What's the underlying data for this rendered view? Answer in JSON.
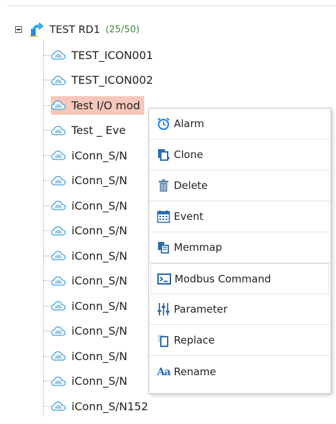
{
  "tree": {
    "root": {
      "label": "TEST RD1",
      "count": "(25/50)",
      "expander_icon": "collapse-minus-icon",
      "icon": "blue-arrow-folder-icon"
    },
    "children": [
      {
        "label": "TEST_ICON001",
        "icon": "cloud-icon"
      },
      {
        "label": "TEST_ICON002",
        "icon": "cloud-icon"
      },
      {
        "label": "Test I/O mod",
        "icon": "cloud-icon",
        "selected": true
      },
      {
        "label": "Test _ Eve",
        "icon": "cloud-icon"
      },
      {
        "label": "iConn_S/N",
        "icon": "cloud-icon"
      },
      {
        "label": "iConn_S/N",
        "icon": "cloud-icon"
      },
      {
        "label": "iConn_S/N",
        "icon": "cloud-icon"
      },
      {
        "label": "iConn_S/N",
        "icon": "cloud-icon"
      },
      {
        "label": "iConn_S/N",
        "icon": "cloud-icon"
      },
      {
        "label": "iConn_S/N",
        "icon": "cloud-icon"
      },
      {
        "label": "iConn_S/N",
        "icon": "cloud-icon"
      },
      {
        "label": "iConn_S/N",
        "icon": "cloud-icon"
      },
      {
        "label": "iConn_S/N",
        "icon": "cloud-icon"
      },
      {
        "label": "iConn_S/N",
        "icon": "cloud-icon"
      },
      {
        "label": "iConn_S/N152",
        "icon": "cloud-icon"
      }
    ],
    "selected_highlight_color": "#f6c7bb"
  },
  "context_menu": {
    "items": [
      {
        "label": "Alarm",
        "icon": "alarm-clock-icon"
      },
      {
        "label": "Clone",
        "icon": "clone-icon"
      },
      {
        "label": "Delete",
        "icon": "trash-icon"
      },
      {
        "label": "Event",
        "icon": "calendar-icon"
      },
      {
        "label": "Memmap",
        "icon": "memmap-icon"
      },
      {
        "label": "Modbus Command",
        "icon": "terminal-icon",
        "hovered": true
      },
      {
        "label": "Parameter",
        "icon": "sliders-icon"
      },
      {
        "label": "Replace",
        "icon": "replace-icon"
      },
      {
        "label": "Rename",
        "icon": "rename-icon",
        "glyph": "Aa"
      }
    ]
  }
}
